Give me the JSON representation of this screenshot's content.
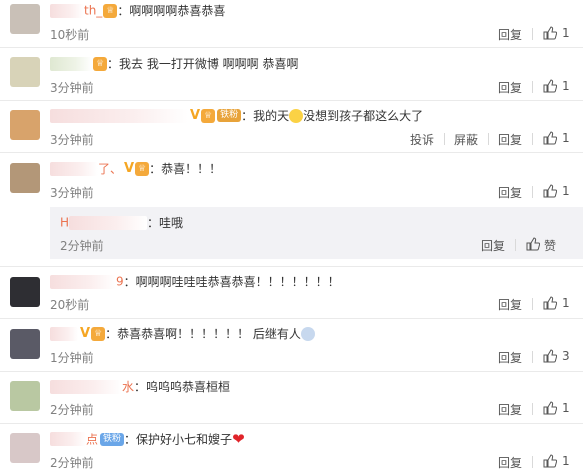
{
  "comments": [
    {
      "handle": "th_",
      "badge_text": "♕",
      "text": "啊啊啊啊恭喜恭喜",
      "time": "10秒前",
      "reply": "回复",
      "like_count": "1"
    },
    {
      "handle": "",
      "badge_text": "♕",
      "text": "我去 我一打开微博 啊啊啊 恭喜啊",
      "time": "3分钟前",
      "reply": "回复",
      "like_count": "1"
    },
    {
      "handle": "",
      "vbadge": "V",
      "badge_text": "♕",
      "fan_badge": "铁粉",
      "text_before": "我的天",
      "text_after": "没想到孩子都这么大了",
      "time": "3分钟前",
      "report": "投诉",
      "block": "屏蔽",
      "reply": "回复",
      "like_count": "1"
    },
    {
      "handle": "了、",
      "vbadge": "V",
      "badge_text": "♕",
      "text": "恭喜！！！",
      "time": "3分钟前",
      "reply": "回复",
      "like_count": "1"
    },
    {
      "handle": "9",
      "text": "啊啊啊哇哇哇恭喜恭喜！！！！！！！",
      "time": "20秒前",
      "reply": "回复",
      "like_count": "1"
    },
    {
      "handle": "",
      "vbadge": "V",
      "badge_text": "♕",
      "text": "恭喜恭喜啊！！！！！！ 后继有人",
      "time": "1分钟前",
      "reply": "回复",
      "like_count": "3"
    },
    {
      "handle": "水",
      "text": "呜呜呜恭喜桓桓",
      "time": "2分钟前",
      "reply": "回复",
      "like_count": "1"
    },
    {
      "handle": "点",
      "fan_badge": "铁粉",
      "text": "保护好小七和嫂子",
      "time": "2分钟前",
      "reply": "回复",
      "like_count": "1"
    }
  ],
  "sub_reply": {
    "handle": "H",
    "text": "哇哦",
    "time": "2分钟前",
    "reply": "回复",
    "like_label": "赞"
  },
  "colors": {
    "handle": "#eb7350",
    "time": "#808080",
    "reply_bg": "#f2f2f5"
  }
}
